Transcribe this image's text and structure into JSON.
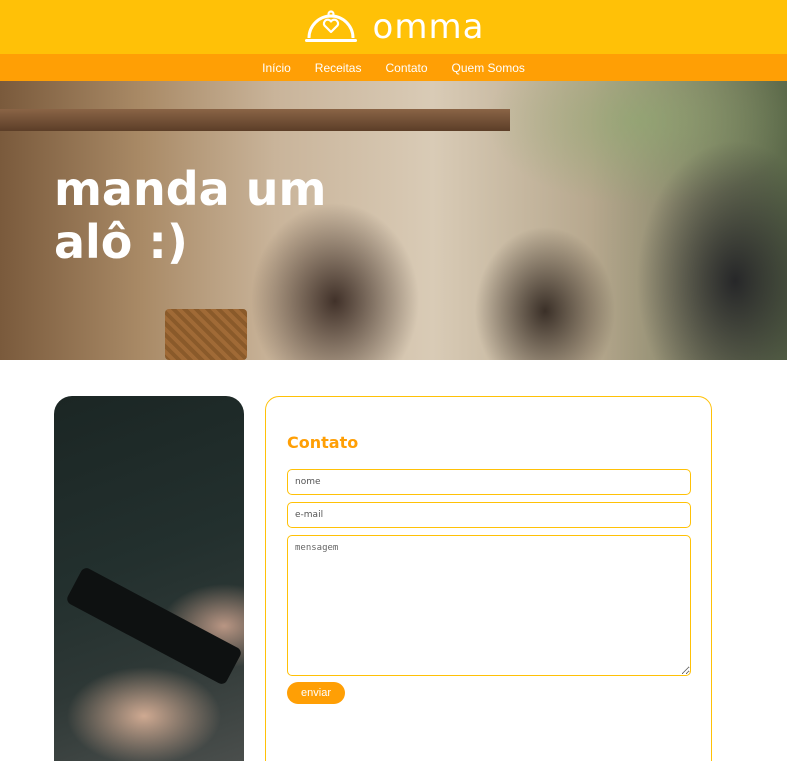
{
  "header": {
    "brand": "omma",
    "logo_icon": "food-cloche-heart-icon"
  },
  "nav": {
    "items": [
      {
        "label": "Início"
      },
      {
        "label": "Receitas"
      },
      {
        "label": "Contato"
      },
      {
        "label": "Quem Somos"
      }
    ]
  },
  "hero": {
    "title_line1": "manda um",
    "title_line2": "alô :)"
  },
  "contact_form": {
    "title": "Contato",
    "name_placeholder": "nome",
    "email_placeholder": "e-mail",
    "message_placeholder": "mensagem",
    "submit_label": "enviar"
  },
  "colors": {
    "header_bg": "#ffc107",
    "nav_bg": "#ff9f05",
    "accent": "#ff9f05",
    "text_light": "#ffffff"
  }
}
